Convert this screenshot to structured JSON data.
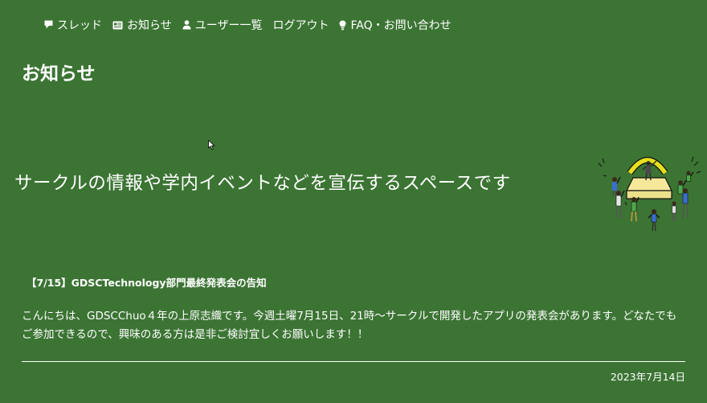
{
  "nav": {
    "items": [
      {
        "label": "スレッド",
        "icon": "comment-icon"
      },
      {
        "label": "お知らせ",
        "icon": "newspaper-icon"
      },
      {
        "label": "ユーザー一覧",
        "icon": "user-icon"
      },
      {
        "label": "ログアウト",
        "icon": ""
      },
      {
        "label": "FAQ・お問い合わせ",
        "icon": "lightbulb-icon"
      }
    ]
  },
  "page": {
    "title": "お知らせ",
    "banner_text": "サークルの情報や学内イベントなどを宣伝するスペースです"
  },
  "post": {
    "title": "【7/15】GDSCTechnology部門最終発表会の告知",
    "body": "こんにちは、GDSCChuo４年の上原志織です。今週土曜7月15日、21時～サークルで開発したアプリの発表会があります。どなたでもご参加できるので、興味のある方は是非ご検討宜しくお願いします！！",
    "date": "2023年7月14日"
  },
  "colors": {
    "background": "#3c7434",
    "text": "#ffffff",
    "illustration_stage": "#f5e89a",
    "illustration_arch": "#e6df1e"
  }
}
